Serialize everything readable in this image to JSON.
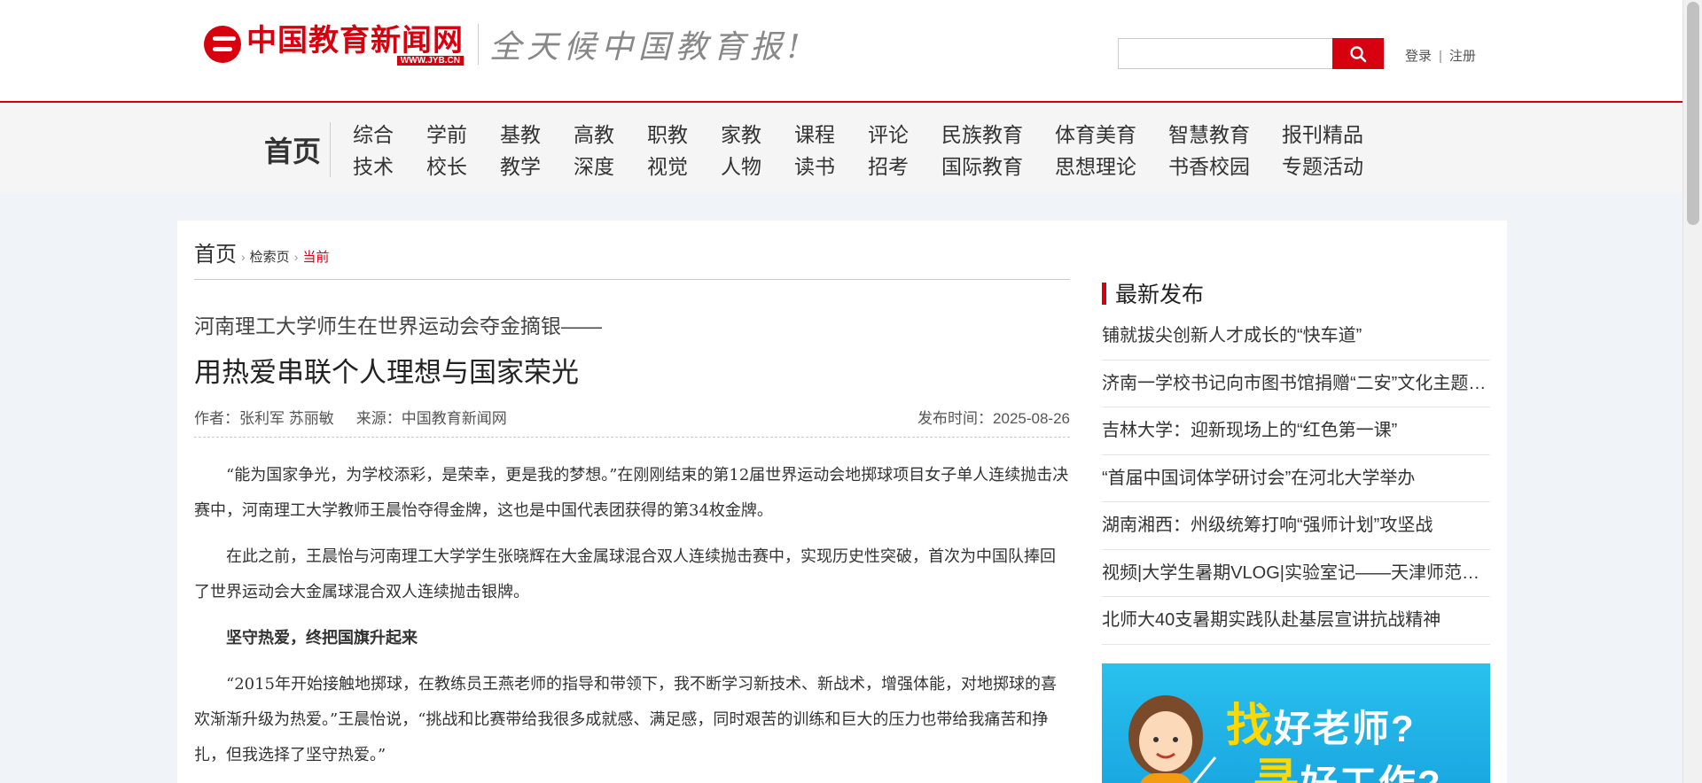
{
  "header": {
    "logo_text": "中国教育新闻网",
    "logo_url": "WWW.JYB.CN",
    "slogan": "全天候中国教育报!",
    "search_placeholder": "",
    "login": "登录",
    "separator": "|",
    "register": "注册"
  },
  "nav": {
    "home": "首页",
    "items": [
      "综合",
      "学前",
      "基教",
      "高教",
      "职教",
      "家教",
      "课程",
      "评论",
      "民族教育",
      "体育美育",
      "智慧教育",
      "报刊精品",
      "技术",
      "校长",
      "教学",
      "深度",
      "视觉",
      "人物",
      "读书",
      "招考",
      "国际教育",
      "思想理论",
      "书香校园",
      "专题活动"
    ]
  },
  "breadcrumb": {
    "home": "首页",
    "search": "检索页",
    "current": "当前",
    "sep": "›"
  },
  "article": {
    "subtitle": "河南理工大学师生在世界运动会夺金摘银——",
    "title": "用热爱串联个人理想与国家荣光",
    "author": "作者：张利军 苏丽敏",
    "source": "来源：中国教育新闻网",
    "date": "发布时间：2025-08-26",
    "paragraphs": [
      "“能为国家争光，为学校添彩，是荣幸，更是我的梦想。”在刚刚结束的第12届世界运动会地掷球项目女子单人连续抛击决赛中，河南理工大学教师王晨怡夺得金牌，这也是中国代表团获得的第34枚金牌。",
      "在此之前，王晨怡与河南理工大学学生张晓辉在大金属球混合双人连续抛击赛中，实现历史性突破，首次为中国队捧回了世界运动会大金属球混合双人连续抛击银牌。",
      "坚守热爱，终把国旗升起来",
      "“2015年开始接触地掷球，在教练员王燕老师的指导和带领下，我不断学习新技术、新战术，增强体能，对地掷球的喜欢渐渐升级为热爱。”王晨怡说，“挑战和比赛带给我很多成就感、满足感，同时艰苦的训练和巨大的压力也带给我痛苦和挣扎，但我选择了坚守热爱。”"
    ]
  },
  "sidebar": {
    "heading": "最新发布",
    "items": [
      "铺就拔尖创新人才成长的“快车道”",
      "济南一学校书记向市图书馆捐赠“二安”文化主题图书",
      "吉林大学：迎新现场上的“红色第一课”",
      "“首届中国词体学研讨会”在河北大学举办",
      "湖南湘西：州级统筹打响“强师计划”攻坚战",
      "视频|大学生暑期VLOG|实验室记——天津师范大学",
      "北师大40支暑期实践队赴基层宣讲抗战精神"
    ],
    "banner_line1_a": "找",
    "banner_line1_b": "好老师?",
    "banner_line2_a": "寻",
    "banner_line2_b": "好工作?"
  },
  "colors": {
    "brand_red": "#d7000f",
    "banner_blue": "#1aa7e0"
  }
}
